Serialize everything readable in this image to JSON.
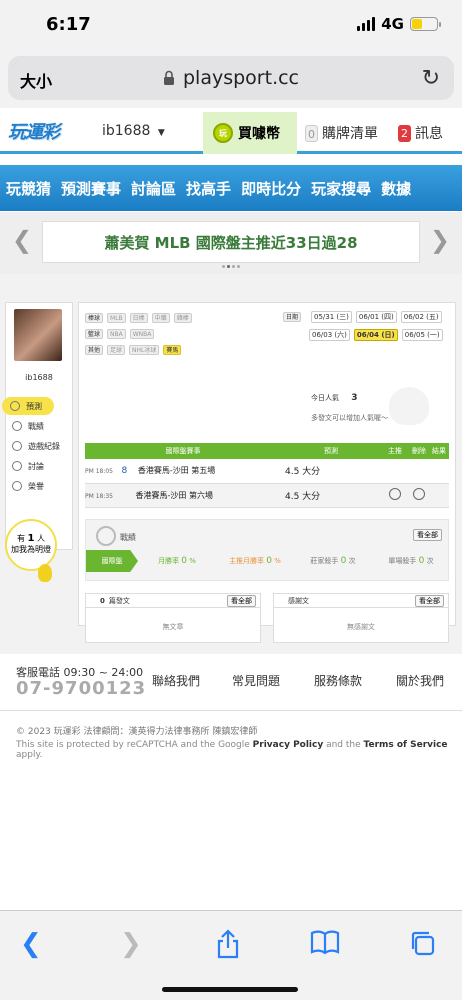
{
  "status": {
    "time": "6:17",
    "network": "4G"
  },
  "browser": {
    "text_size": "大小",
    "url": "playsport.cc"
  },
  "header": {
    "logo": "玩運彩",
    "username": "ib1688",
    "coins_label": "買噱幣",
    "cart_count": "0",
    "cart_label": "購牌清單",
    "msg_count": "2",
    "msg_label": "訊息"
  },
  "nav": {
    "items": [
      "玩競猜",
      "預測賽事",
      "討論區",
      "找高手",
      "即時比分",
      "玩家搜尋",
      "數據"
    ]
  },
  "banner": {
    "text": "蕭美賀 MLB 國際盤主推近33日過28"
  },
  "sidebar": {
    "username": "ib1688",
    "items": [
      "預測",
      "戰績",
      "遊戲紀錄",
      "討論",
      "榮譽"
    ],
    "fans_prefix": "有",
    "fans_count": "1",
    "fans_suffix": "人",
    "fans_label": "加我為明燈"
  },
  "filters": {
    "rows": [
      {
        "label": "棒球",
        "tags": [
          "MLB",
          "日棒",
          "中職",
          "韓棒"
        ]
      },
      {
        "label": "籃球",
        "tags": [
          "NBA",
          "WNBA"
        ]
      },
      {
        "label": "其他",
        "tags": [
          "足球",
          "NHL冰球",
          "賽馬"
        ]
      }
    ],
    "active_tag": "賽馬",
    "date_label": "日期",
    "dates": [
      "05/31 (三)",
      "06/01 (四)",
      "06/02 (五)",
      "06/03 (六)",
      "06/04 (日)",
      "06/05 (一)"
    ],
    "active_date": "06/04 (日)"
  },
  "popularity": {
    "label": "今日人氣",
    "value": "3",
    "hint": "多發文可以增加人氣喔～"
  },
  "picks_table": {
    "headers": [
      "國際盤賽事",
      "預測",
      "主推",
      "刪除",
      "結果"
    ],
    "rows": [
      {
        "time": "PM 18:05",
        "no": "8",
        "match": "香港賽馬-沙田 第五場",
        "pick": "4.5 大分"
      },
      {
        "time": "PM 18:35",
        "no": "",
        "match": "香港賽馬-沙田 第六場",
        "pick": "4.5 大分"
      }
    ]
  },
  "record": {
    "title": "戰績",
    "see_all": "看全部",
    "tab": "國際盤",
    "stats": [
      {
        "label": "月勝率",
        "value": "0",
        "unit": "%"
      },
      {
        "label": "主推月勝率",
        "value": "0",
        "unit": "%"
      },
      {
        "label": "莊家殺手",
        "value": "0",
        "unit": "次"
      },
      {
        "label": "單場殺手",
        "value": "0",
        "unit": "次"
      }
    ]
  },
  "posts": {
    "count": "0",
    "title": "篇發文",
    "see_all": "看全部",
    "empty": "無文章"
  },
  "replies": {
    "title": "感謝文",
    "see_all": "看全部",
    "empty": "無感謝文"
  },
  "footer": {
    "hours": "客服電話 09:30 ~ 24:00",
    "phone": "07-9700123",
    "links": [
      "聯絡我們",
      "常見問題",
      "服務條款",
      "關於我們"
    ],
    "copyright": "© 2023 玩運彩 法律顧問：漢英得力法律事務所 陳鎮宏律師",
    "recaptcha_a": "This site is protected by reCAPTCHA and the Google ",
    "privacy": "Privacy Policy",
    "recaptcha_and": " and the ",
    "terms": "Terms of Service",
    "recaptcha_b": " apply."
  },
  "colors": {
    "accent_blue": "#1b7dc4",
    "accent_green": "#6bb631",
    "highlight_yellow": "#f7e24a",
    "ios_blue": "#2a7ff6"
  }
}
